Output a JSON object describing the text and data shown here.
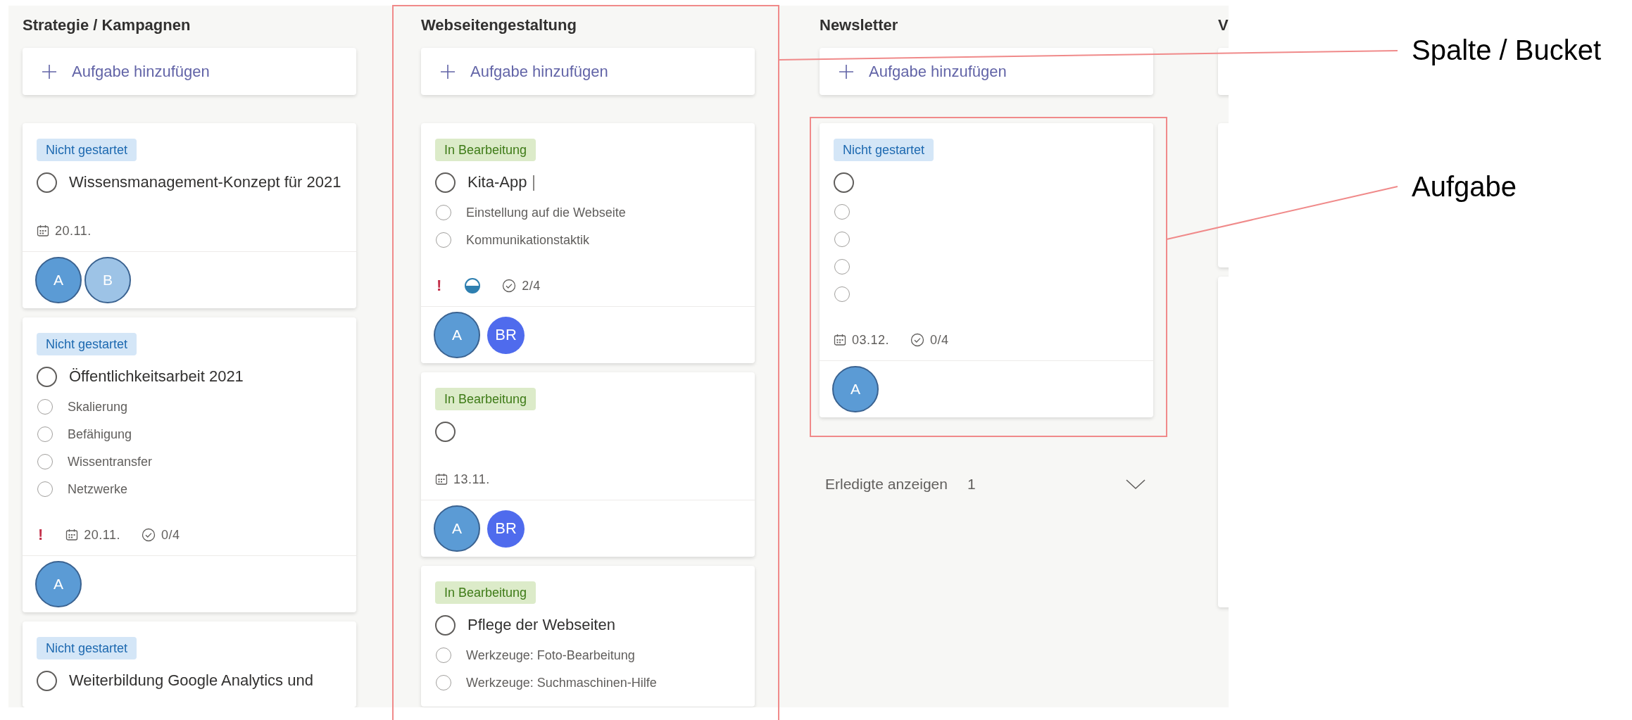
{
  "columns": [
    {
      "title": "Strategie / Kampagnen",
      "add_label": "Aufgabe hinzufügen",
      "tasks": [
        {
          "status": {
            "label": "Nicht gestartet",
            "kind": "not_started"
          },
          "completed": false,
          "title": "Wissensmanagement-Konzept für 2021",
          "due": "20.11.",
          "assignees": [
            {
              "initials": "A",
              "color": "#5b9bd5",
              "outlined": true
            },
            {
              "initials": "B",
              "color": "#9dc3e6",
              "outlined": true
            }
          ]
        },
        {
          "status": {
            "label": "Nicht gestartet",
            "kind": "not_started"
          },
          "completed": false,
          "title": "Öffentlichkeitsarbeit 2021",
          "checklist": [
            {
              "label": "Skalierung",
              "checked": false
            },
            {
              "label": "Befähigung",
              "checked": false
            },
            {
              "label": "Wissentransfer",
              "checked": false
            },
            {
              "label": "Netzwerke",
              "checked": false
            }
          ],
          "priority": "!",
          "due": "20.11.",
          "checklist_count": "0/4",
          "assignees": [
            {
              "initials": "A",
              "color": "#5b9bd5",
              "outlined": true
            }
          ]
        },
        {
          "status": {
            "label": "Nicht gestartet",
            "kind": "not_started"
          },
          "completed": false,
          "title": "Weiterbildung Google Analytics und"
        }
      ]
    },
    {
      "title": "Webseitengestaltung",
      "add_label": "Aufgabe hinzufügen",
      "tasks": [
        {
          "status": {
            "label": "In Bearbeitung",
            "kind": "in_progress"
          },
          "completed": false,
          "title": "Kita-App",
          "editing": true,
          "checklist": [
            {
              "label": "Einstellung auf die Webseite",
              "checked": false
            },
            {
              "label": "Kommunikationstaktik",
              "checked": false
            }
          ],
          "priority": "!",
          "in_progress": true,
          "checklist_count": "2/4",
          "assignees": [
            {
              "initials": "A",
              "color": "#5b9bd5",
              "outlined": true
            },
            {
              "initials": "BR",
              "color": "#4f6bed",
              "outlined": false
            }
          ]
        },
        {
          "status": {
            "label": "In Bearbeitung",
            "kind": "in_progress"
          },
          "completed": false,
          "due": "13.11.",
          "assignees": [
            {
              "initials": "A",
              "color": "#5b9bd5",
              "outlined": true
            },
            {
              "initials": "BR",
              "color": "#4f6bed",
              "outlined": false
            }
          ]
        },
        {
          "status": {
            "label": "In Bearbeitung",
            "kind": "in_progress"
          },
          "completed": false,
          "title": "Pflege der Webseiten",
          "checklist": [
            {
              "label": "Werkzeuge: Foto-Bearbeitung",
              "checked": false
            },
            {
              "label": "Werkzeuge: Suchmaschinen-Hilfe",
              "checked": false
            }
          ]
        }
      ]
    },
    {
      "title": "Newsletter",
      "add_label": "Aufgabe hinzufügen",
      "tasks": [
        {
          "status": {
            "label": "Nicht gestartet",
            "kind": "not_started"
          },
          "completed": false,
          "checklist": [
            {
              "checked": false
            },
            {
              "checked": false
            },
            {
              "checked": false
            },
            {
              "checked": false
            }
          ],
          "due": "03.12.",
          "checklist_count": "0/4",
          "assignees": [
            {
              "initials": "A",
              "color": "#5b9bd5",
              "outlined": true
            }
          ]
        }
      ],
      "completed_toggle": {
        "label": "Erledigte anzeigen",
        "count": "1"
      }
    },
    {
      "title": "V",
      "clipped": true
    }
  ],
  "annotations": [
    {
      "label": "Spalte / Bucket"
    },
    {
      "label": "Aufgabe"
    }
  ]
}
